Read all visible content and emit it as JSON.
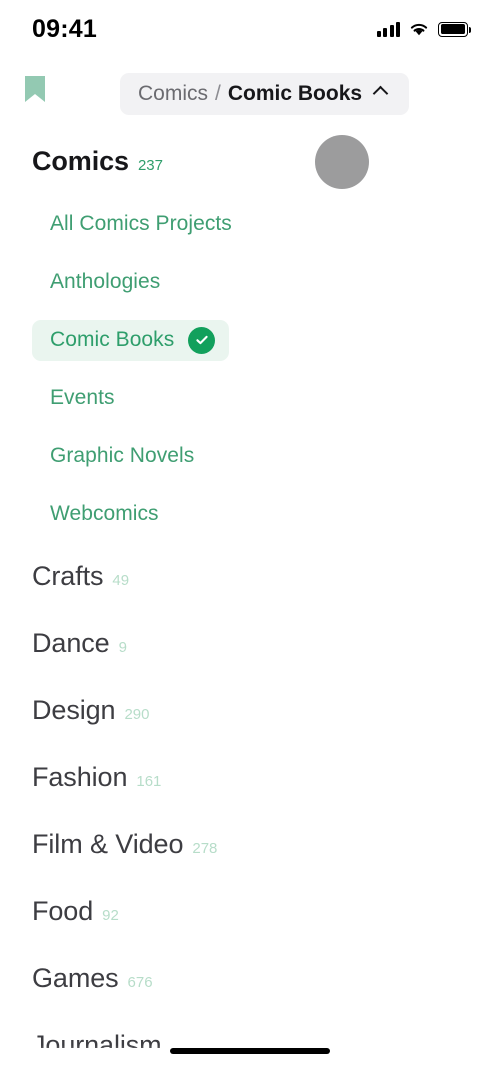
{
  "status_bar": {
    "time": "09:41",
    "signal_icon": "cellular-signal-icon",
    "wifi_icon": "wifi-icon",
    "battery_icon": "battery-full-icon"
  },
  "navbar": {
    "bookmark_icon": "bookmark-icon",
    "breadcrumb": {
      "parent": "Comics",
      "separator": "/",
      "current": "Comic Books",
      "chevron_icon": "chevron-up-icon"
    },
    "tap_indicator": "touch-indicator"
  },
  "list": {
    "categories": [
      {
        "name": "Comics",
        "count": "237",
        "active": true,
        "subcategories": [
          {
            "name": "All Comics Projects",
            "selected": false
          },
          {
            "name": "Anthologies",
            "selected": false
          },
          {
            "name": "Comic Books",
            "selected": true,
            "check_icon": "check-circle-icon"
          },
          {
            "name": "Events",
            "selected": false
          },
          {
            "name": "Graphic Novels",
            "selected": false
          },
          {
            "name": "Webcomics",
            "selected": false
          }
        ]
      },
      {
        "name": "Crafts",
        "count": "49",
        "active": false
      },
      {
        "name": "Dance",
        "count": "9",
        "active": false
      },
      {
        "name": "Design",
        "count": "290",
        "active": false
      },
      {
        "name": "Fashion",
        "count": "161",
        "active": false
      },
      {
        "name": "Film & Video",
        "count": "278",
        "active": false
      },
      {
        "name": "Food",
        "count": "92",
        "active": false
      },
      {
        "name": "Games",
        "count": "676",
        "active": false
      },
      {
        "name": "Journalism",
        "count": "",
        "active": false
      }
    ]
  },
  "home_indicator": "home-indicator",
  "colors": {
    "accent_green": "#12a05c",
    "link_green": "#3f9e72",
    "count_green": "#b7ddc9",
    "selected_pill": "#eaf5ef",
    "breadcrumb_pill": "#f2f2f4",
    "text_dark": "#17171a",
    "text_muted": "#6b6b70"
  }
}
